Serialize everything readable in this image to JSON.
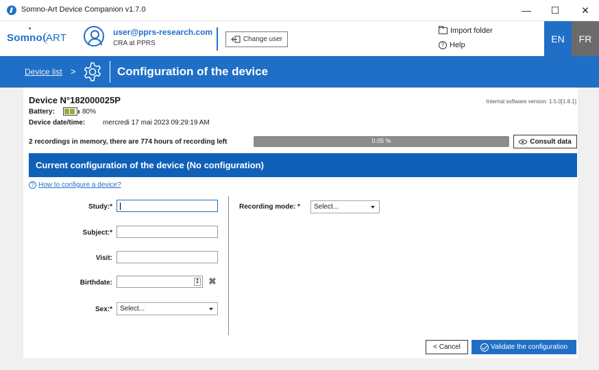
{
  "window": {
    "title": "Somno-Art Device Companion v1.7.0",
    "minimize": "—",
    "maximize": "☐",
    "close": "✕"
  },
  "header": {
    "logo_somno": "Somno",
    "logo_art": "ART",
    "user_email": "user@pprs-research.com",
    "user_role": "CRA at PPRS",
    "change_user": "Change user",
    "import_folder": "Import folder",
    "help": "Help",
    "lang_en": "EN",
    "lang_fr": "FR",
    "accent_color": "#1f6fc6"
  },
  "banner": {
    "breadcrumb_link": "Device list",
    "breadcrumb_sep": ">",
    "title": "Configuration of the device"
  },
  "device": {
    "id": "Device N°182000025P",
    "software_version": "Internal software version: 1.5.0[1.8.1]",
    "battery_label": "Battery:",
    "battery_pct": "80%",
    "datetime_label": "Device date/time:",
    "datetime_value": "mercredi 17 mai 2023 09:29:19 AM",
    "recording_info": "2 recordings in memory, there are 774 hours of recording left",
    "memory_used_pct": 0.05,
    "memory_used_text": "0.05 %",
    "consult_data": "Consult data"
  },
  "config": {
    "title": "Current configuration of the device (No configuration)",
    "how_to": "How to configure a device?",
    "study_label": "Study:*",
    "study_value": "",
    "subject_label": "Subject:*",
    "subject_value": "",
    "visit_label": "Visit:",
    "visit_value": "",
    "birthdate_label": "Birthdate:",
    "birthdate_value": "",
    "sex_label": "Sex:*",
    "sex_value": "Select...",
    "recording_mode_label": "Recording mode: *",
    "recording_mode_value": "Select..."
  },
  "actions": {
    "cancel": "< Cancel",
    "validate": "Validate the configuration"
  }
}
